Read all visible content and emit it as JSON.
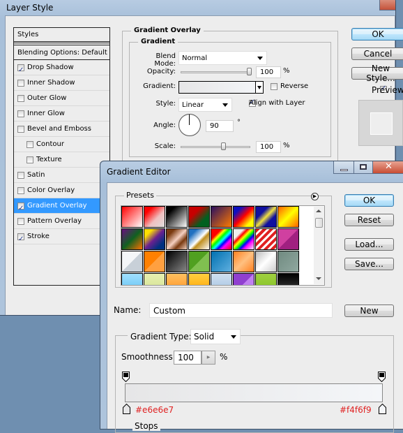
{
  "layer_style": {
    "title": "Layer Style",
    "styles_header": "Styles",
    "blending_options": "Blending Options: Default",
    "items": [
      {
        "label": "Drop Shadow",
        "checked": true,
        "indent": false,
        "selected": false
      },
      {
        "label": "Inner Shadow",
        "checked": false,
        "indent": false,
        "selected": false
      },
      {
        "label": "Outer Glow",
        "checked": false,
        "indent": false,
        "selected": false
      },
      {
        "label": "Inner Glow",
        "checked": false,
        "indent": false,
        "selected": false
      },
      {
        "label": "Bevel and Emboss",
        "checked": false,
        "indent": false,
        "selected": false
      },
      {
        "label": "Contour",
        "checked": false,
        "indent": true,
        "selected": false
      },
      {
        "label": "Texture",
        "checked": false,
        "indent": true,
        "selected": false
      },
      {
        "label": "Satin",
        "checked": false,
        "indent": false,
        "selected": false
      },
      {
        "label": "Color Overlay",
        "checked": false,
        "indent": false,
        "selected": false
      },
      {
        "label": "Gradient Overlay",
        "checked": true,
        "indent": false,
        "selected": true
      },
      {
        "label": "Pattern Overlay",
        "checked": false,
        "indent": false,
        "selected": false
      },
      {
        "label": "Stroke",
        "checked": true,
        "indent": false,
        "selected": false
      }
    ],
    "section_title": "Gradient Overlay",
    "group_title": "Gradient",
    "blend_mode_label": "Blend Mode:",
    "blend_mode": "Normal",
    "opacity_label": "Opacity:",
    "opacity": "100",
    "opacity_unit": "%",
    "gradient_label": "Gradient:",
    "reverse_label": "Reverse",
    "reverse_checked": false,
    "style_label": "Style:",
    "style": "Linear",
    "align_label": "Align with Layer",
    "align_checked": true,
    "angle_label": "Angle:",
    "angle": "90",
    "angle_unit": "°",
    "scale_label": "Scale:",
    "scale": "100",
    "scale_unit": "%",
    "ok": "OK",
    "cancel": "Cancel",
    "new_style": "New Style...",
    "preview_label": "Preview",
    "preview_checked": true
  },
  "gradient_editor": {
    "title": "Gradient Editor",
    "presets_label": "Presets",
    "presets": [
      "linear-gradient(135deg,#ff0000,#fff)",
      "linear-gradient(135deg,#ff0000 20%,#f0c0c0 60%,#ddd)",
      "linear-gradient(135deg,#000 20%,#fff)",
      "linear-gradient(135deg,#c80000 30%,#006020 70%)",
      "linear-gradient(135deg,#2a1060,#ff7a00)",
      "linear-gradient(135deg,#1010c0 20%,#ff0000 50%,#ffff00 80%)",
      "linear-gradient(135deg,#1010a0 30%,#f0e040 50%,#1010a0 70%)",
      "linear-gradient(135deg,#ff6000,#ffff00 50%,#ff6000)",
      "linear-gradient(135deg,#6a1080,#106020 50%,#ff7000)",
      "linear-gradient(135deg,#ffe000 20%,#6a2090 50%,#003080 80%)",
      "linear-gradient(135deg,#7a3a10 20%,#f5d0c0 50%,#7a3a10 70%,#f0d0c0)",
      "linear-gradient(135deg,#2070c0 20%,#fff 50%,#c09020 60%,#fff)",
      "linear-gradient(135deg,#ff0000 25%,#ffff00 35%,#00ff00 45%,#00ffff 55%,#0000ff 65%,#ff00ff 75%,#ff0000)",
      "linear-gradient(135deg,#eee 25%,#ff0000 35%,#ffff00 45%,#00ff00 55%,#0000ff 65%,#ff00ff 75%,#eee)",
      "repeating-linear-gradient(135deg,#e02020 0 4px,#fff 4px 7px)",
      "linear-gradient(135deg,#d040a0 50%,#a02080 50%)",
      "linear-gradient(135deg,#f4f6f8 50%,#c8d0d8 50%)",
      "linear-gradient(135deg,#ff8000 50%,#ffa040 50%)",
      "linear-gradient(135deg,#000,#888)",
      "linear-gradient(135deg,#50a020 50%,#80c050 50%)",
      "linear-gradient(135deg,#0070b0,#60b0e0)",
      "linear-gradient(135deg,#ff8020,#ffc080 50%,#ff8020)",
      "linear-gradient(135deg,#bbb,#fff 50%,#ccc)",
      "linear-gradient(135deg,#708a80,#90a8a0)",
      "linear-gradient(#a0e0ff,#60c0f0)",
      "linear-gradient(#e8f0b0,#d0e090)",
      "linear-gradient(#ffc060,#ff9020)",
      "linear-gradient(#ffd040,#ffa000)",
      "linear-gradient(#d0e0f0,#a0c0e0)",
      "linear-gradient(135deg,#9040d0 50%,#c080f0 50%)",
      "linear-gradient(#a0d040,#80c020)",
      "linear-gradient(#000,#444)"
    ],
    "ok": "OK",
    "reset": "Reset",
    "load": "Load...",
    "save": "Save...",
    "name_label": "Name:",
    "name_value": "Custom",
    "new": "New",
    "gradient_type_label": "Gradient Type:",
    "gradient_type": "Solid",
    "smoothness_label": "Smoothness:",
    "smoothness": "100",
    "smoothness_unit": "%",
    "gradient_start": "#e6e6e7",
    "gradient_end": "#f4f6f9",
    "stop_left_label": "#e6e6e7",
    "stop_right_label": "#f4f6f9",
    "stops_label": "Stops"
  },
  "colors": {
    "selection": "#3399ff",
    "annotation": "#e02020"
  }
}
